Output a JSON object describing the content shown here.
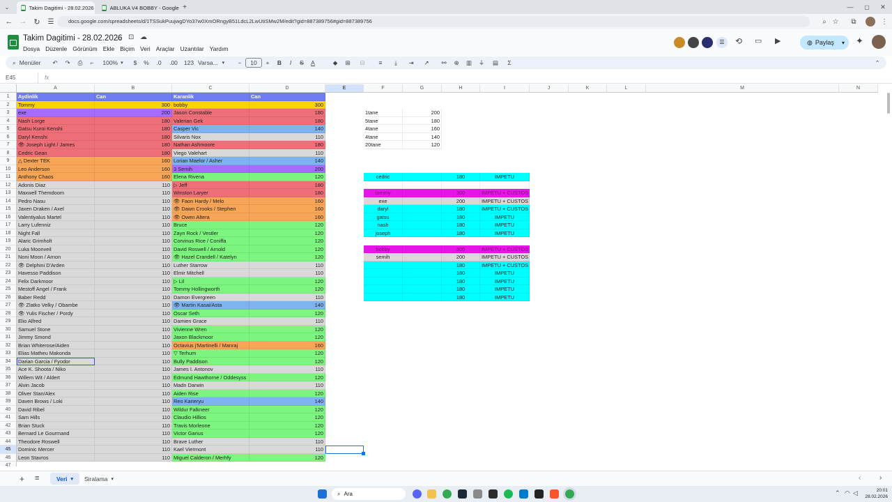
{
  "browser": {
    "tabs": [
      {
        "title": "Takim Dagitimi - 28.02.2026 - G",
        "active": true
      },
      {
        "title": "ABLUKA V4 BOBBY - Google E",
        "active": false
      }
    ],
    "url": "docs.google.com/spreadsheets/d/1TSSukPuujwgDYo37w0XmORngyB51LdcL2LwUtiSMw2M/edit?gid=887389756#gid=887389756"
  },
  "doc": {
    "title": "Takim Dagitimi - 28.02.2026",
    "menus": [
      "Dosya",
      "Düzenle",
      "Görünüm",
      "Ekle",
      "Biçim",
      "Veri",
      "Araçlar",
      "Uzantılar",
      "Yardım"
    ],
    "share_label": "Paylaş"
  },
  "toolbar": {
    "search": "Menüler",
    "zoom": "100%",
    "currency": "$",
    "percent": "%",
    "dec_minus": ".0",
    "dec_plus": ".00",
    "number_format": "123",
    "font": "Varsa...",
    "font_size": "10",
    "bold": "B",
    "italic": "I",
    "strike": "S",
    "text_color": "A"
  },
  "formula_bar": {
    "cell_ref": "E45",
    "fx": "fx",
    "value": ""
  },
  "columns": [
    "A",
    "B",
    "C",
    "D",
    "E",
    "F",
    "G",
    "H",
    "I",
    "J",
    "K",
    "L",
    "M",
    "N"
  ],
  "selected_column": "E",
  "selected_row": 45,
  "colors": {
    "header_blue": "#6d7cf0",
    "yellow": "#fbd400",
    "purple": "#a66cff",
    "red": "#ef6f78",
    "orange": "#f7a657",
    "blue": "#7fb3ef",
    "gray": "#d9d9d9",
    "green": "#7cf67f",
    "cyan": "#00ffff",
    "magenta": "#e617e6",
    "selection": "#1a73e8"
  },
  "left_table": [
    {
      "a": "Aydinlik",
      "b": "Can",
      "c": "Karanlik",
      "d": "Can",
      "ca": "header_blue",
      "cc": "header_blue"
    },
    {
      "a": "Tommy",
      "b": "300",
      "c": "bobby",
      "d": "300",
      "ca": "yellow",
      "cc": "yellow"
    },
    {
      "a": "exe",
      "b": "200",
      "c": "Jason Constable",
      "d": "180",
      "ca": "purple",
      "cc": "red"
    },
    {
      "a": "Nash Lorge",
      "b": "180",
      "c": "Valerian Gek",
      "d": "180",
      "ca": "red",
      "cc": "red"
    },
    {
      "a": "Gatsu Kuroi Kenshi",
      "b": "180",
      "c": "Casper Vic",
      "d": "140",
      "ca": "red",
      "cc": "blue"
    },
    {
      "a": "Daryl Kenshi",
      "b": "180",
      "c": "Silvaris Nox",
      "d": "110",
      "ca": "red",
      "cc": "gray"
    },
    {
      "a": "👁 Joseph Light / James",
      "b": "180",
      "c": "Nathan Ashmoore",
      "d": "180",
      "ca": "red",
      "cc": "red"
    },
    {
      "a": "Cedric Gean",
      "b": "180",
      "c": "Viego Valehart",
      "d": "110",
      "ca": "red",
      "cc": "gray"
    },
    {
      "a": "△ Dexter TEK",
      "b": "160",
      "c": "Lorian Maelor / Asher",
      "d": "140",
      "ca": "orange",
      "cc": "blue"
    },
    {
      "a": "Leo Anderson",
      "b": "160",
      "c": "3 Semih",
      "d": "200",
      "ca": "orange",
      "cc": "purple"
    },
    {
      "a": "Anthony Chaos",
      "b": "160",
      "c": "Elena Rivena",
      "d": "120",
      "ca": "orange",
      "cc": "green"
    },
    {
      "a": "Adonis Diaz",
      "b": "110",
      "c": "▷ Jeff",
      "d": "180",
      "ca": "gray",
      "cc": "red"
    },
    {
      "a": "Maxwell Themdoom",
      "b": "110",
      "c": "Winston Laryer",
      "d": "180",
      "ca": "gray",
      "cc": "red"
    },
    {
      "a": "Pedro Nasu",
      "b": "110",
      "c": "👁 Faon Hardy / Melo",
      "d": "160",
      "ca": "gray",
      "cc": "orange"
    },
    {
      "a": "Jaxen Draken / Axel",
      "b": "110",
      "c": "👁 Dawn Crooks / Stephen",
      "d": "160",
      "ca": "gray",
      "cc": "orange"
    },
    {
      "a": "Valentiyalus Martel",
      "b": "110",
      "c": "👁 Owen Altera",
      "d": "160",
      "ca": "gray",
      "cc": "orange"
    },
    {
      "a": "Larry Lufenniz",
      "b": "110",
      "c": "Bruce",
      "d": "120",
      "ca": "gray",
      "cc": "green"
    },
    {
      "a": "Night Fall",
      "b": "110",
      "c": "Zayn Rock / Vestler",
      "d": "120",
      "ca": "gray",
      "cc": "green"
    },
    {
      "a": "Alaric Grimholt",
      "b": "110",
      "c": "Corvinus Rice / Coniffa",
      "d": "120",
      "ca": "gray",
      "cc": "green"
    },
    {
      "a": "Luka Moonveil",
      "b": "110",
      "c": "David Roswell / Arnold",
      "d": "120",
      "ca": "gray",
      "cc": "green"
    },
    {
      "a": "Noni Moon / Arnon",
      "b": "110",
      "c": "👁 Hazel Crandell / Katelyn",
      "d": "120",
      "ca": "gray",
      "cc": "green"
    },
    {
      "a": "👁 Delphini D'Arden",
      "b": "110",
      "c": "Luther Starrow",
      "d": "110",
      "ca": "gray",
      "cc": "gray"
    },
    {
      "a": "Havesso Paddison",
      "b": "110",
      "c": "Elmir Mitchell",
      "d": "110",
      "ca": "gray",
      "cc": "gray"
    },
    {
      "a": "Felix Darkmoor",
      "b": "110",
      "c": "▷ Lil",
      "d": "120",
      "ca": "gray",
      "cc": "green"
    },
    {
      "a": "Mestoff Angel / Frank",
      "b": "110",
      "c": "Tommy Hollingworth",
      "d": "120",
      "ca": "gray",
      "cc": "green"
    },
    {
      "a": "Baber Redd",
      "b": "110",
      "c": "Damon Evergreen",
      "d": "110",
      "ca": "gray",
      "cc": "gray"
    },
    {
      "a": "👁 Zlatko Velky / Obambe",
      "b": "110",
      "c": "👁 Martin Kasai/Asta",
      "d": "140",
      "ca": "gray",
      "cc": "blue"
    },
    {
      "a": "👁 Yulis Fischer / Pordy",
      "b": "110",
      "c": "Oscar Seth",
      "d": "120",
      "ca": "gray",
      "cc": "green"
    },
    {
      "a": "Elio Alfred",
      "b": "110",
      "c": "Damien Grace",
      "d": "110",
      "ca": "gray",
      "cc": "gray"
    },
    {
      "a": "Samuel Stone",
      "b": "110",
      "c": "Vivienne Wren",
      "d": "120",
      "ca": "gray",
      "cc": "green"
    },
    {
      "a": "Jimmy Smond",
      "b": "110",
      "c": "Jaxon Blackmoor",
      "d": "120",
      "ca": "gray",
      "cc": "green"
    },
    {
      "a": "Brian Whiterose/Aiden",
      "b": "110",
      "c": "Octavius j'Martinelli / Manraj",
      "d": "160",
      "ca": "gray",
      "cc": "orange"
    },
    {
      "a": "Elias Matheu Makonda",
      "b": "110",
      "c": "▽ Terhum",
      "d": "120",
      "ca": "gray",
      "cc": "green"
    },
    {
      "a": "Darian Garcia / Fyodor",
      "b": "110",
      "c": "Bully Paddison",
      "d": "120",
      "ca": "gray",
      "cc": "green"
    },
    {
      "a": "Ace K. Shoota / Niko",
      "b": "110",
      "c": "James I. Antonov",
      "d": "110",
      "ca": "gray",
      "cc": "gray"
    },
    {
      "a": "Willem Wit / Aldert",
      "b": "110",
      "c": "Edmund Hawthorne / Oddesyss",
      "d": "120",
      "ca": "gray",
      "cc": "green"
    },
    {
      "a": "Alvin Jacob",
      "b": "110",
      "c": "Madn Darwin",
      "d": "110",
      "ca": "gray",
      "cc": "gray"
    },
    {
      "a": "Oliver Stan/Alex",
      "b": "110",
      "c": "Aiden Rise",
      "d": "120",
      "ca": "gray",
      "cc": "green"
    },
    {
      "a": "Daven Brows / Loki",
      "b": "110",
      "c": "Reo Kaneryu",
      "d": "140",
      "ca": "gray",
      "cc": "blue"
    },
    {
      "a": "David Ribel",
      "b": "110",
      "c": "Wildur Falkneer",
      "d": "120",
      "ca": "gray",
      "cc": "green"
    },
    {
      "a": "Sam Hills",
      "b": "110",
      "c": "Claudio Hillios",
      "d": "120",
      "ca": "gray",
      "cc": "green"
    },
    {
      "a": "Brian Stuck",
      "b": "110",
      "c": "Travis Morleone",
      "d": "120",
      "ca": "gray",
      "cc": "green"
    },
    {
      "a": "Bernard Le Gourmand",
      "b": "110",
      "c": "Victor Garius",
      "d": "120",
      "ca": "gray",
      "cc": "green"
    },
    {
      "a": "Theodore Roswell",
      "b": "110",
      "c": "Brave Luther",
      "d": "110",
      "ca": "gray",
      "cc": "gray"
    },
    {
      "a": "Dominic Mercer",
      "b": "110",
      "c": "Kael Viermont",
      "d": "110",
      "ca": "gray",
      "cc": "gray"
    },
    {
      "a": "Leon Stavros",
      "b": "110",
      "c": "Miguel Calderon / Merhfy",
      "d": "120",
      "ca": "gray",
      "cc": "green"
    }
  ],
  "summary_table": [
    {
      "f": "1tane",
      "g": "200"
    },
    {
      "f": "5tane",
      "g": "180"
    },
    {
      "f": "4tane",
      "g": "160"
    },
    {
      "f": "4tane",
      "g": "140"
    },
    {
      "f": "20tane",
      "g": "120"
    }
  ],
  "team_blocks": [
    {
      "row": 11,
      "f": "cedric",
      "h": "180",
      "i": "IMPETU",
      "color": "cyan"
    },
    {
      "row": 12,
      "f": "",
      "h": "",
      "i": "",
      "color": "white"
    },
    {
      "row": 13,
      "f": "tommy",
      "h": "300",
      "i": "IMPETU + CUSTOS",
      "color": "magenta"
    },
    {
      "row": 14,
      "f": "exe",
      "h": "200",
      "i": "IMPETU + CUSTOS",
      "color": "gray"
    },
    {
      "row": 15,
      "f": "daryl",
      "h": "180",
      "i": "IMPETU + CUSTOS",
      "color": "cyan"
    },
    {
      "row": 16,
      "f": "gatsu",
      "h": "180",
      "i": "IMPETU",
      "color": "cyan"
    },
    {
      "row": 17,
      "f": "nash",
      "h": "180",
      "i": "IMPETU",
      "color": "cyan"
    },
    {
      "row": 18,
      "f": "joseph",
      "h": "180",
      "i": "IMPETU",
      "color": "cyan"
    },
    {
      "row": 20,
      "f": "bobby",
      "h": "300",
      "i": "IMPETU + CUSTOS",
      "color": "magenta"
    },
    {
      "row": 21,
      "f": "semih",
      "h": "200",
      "i": "IMPETU + CUSTOS",
      "color": "gray"
    },
    {
      "row": 22,
      "f": "",
      "h": "180",
      "i": "IMPETU + CUSTOS",
      "color": "cyan"
    },
    {
      "row": 23,
      "f": "",
      "h": "180",
      "i": "IMPETU",
      "color": "cyan"
    },
    {
      "row": 24,
      "f": "",
      "h": "180",
      "i": "IMPETU",
      "color": "cyan"
    },
    {
      "row": 25,
      "f": "",
      "h": "180",
      "i": "IMPETU",
      "color": "cyan"
    },
    {
      "row": 26,
      "f": "",
      "h": "180",
      "i": "IMPETU",
      "color": "cyan"
    }
  ],
  "sheets": [
    {
      "name": "Veri",
      "active": true
    },
    {
      "name": "Siralama",
      "active": false
    }
  ],
  "taskbar": {
    "search": "Ara",
    "time": "20:01",
    "date": "28.02.2026"
  }
}
